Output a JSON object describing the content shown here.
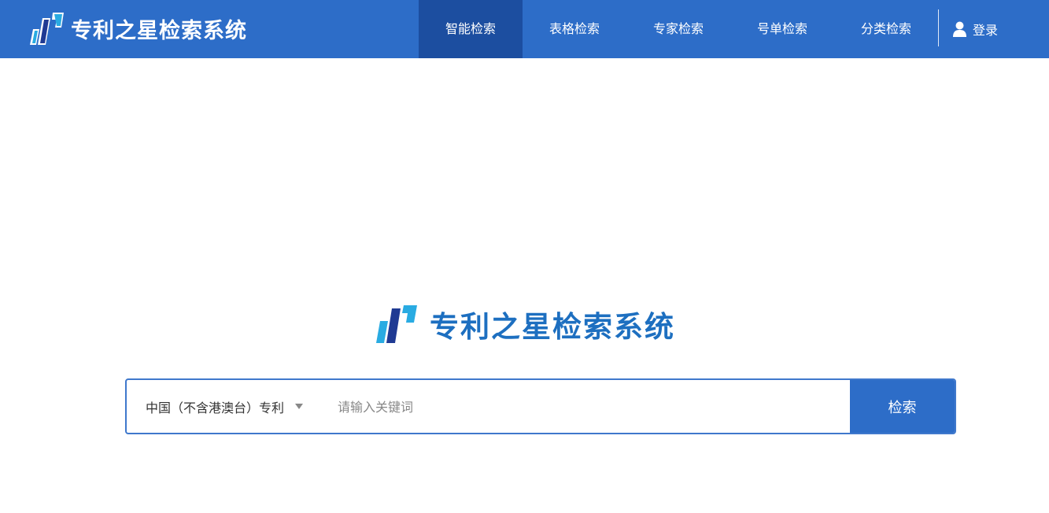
{
  "header": {
    "brand_name": "专利之星检索系统",
    "nav": [
      {
        "label": "智能检索",
        "active": true
      },
      {
        "label": "表格检索",
        "active": false
      },
      {
        "label": "专家检索",
        "active": false
      },
      {
        "label": "号单检索",
        "active": false
      },
      {
        "label": "分类检索",
        "active": false
      }
    ],
    "login_label": "登录",
    "login_icon": "user-icon"
  },
  "hero": {
    "title": "专利之星检索系统"
  },
  "search": {
    "scope_selected": "中国（不含港澳台）专利",
    "placeholder": "请输入关键词",
    "value": "",
    "button_label": "检索"
  },
  "colors": {
    "header_bg": "#2d6dc8",
    "nav_active_bg": "#1c4ea0",
    "brand_blue": "#1d6fc0",
    "logo_light": "#29abe2",
    "logo_dark": "#1f3a93"
  }
}
